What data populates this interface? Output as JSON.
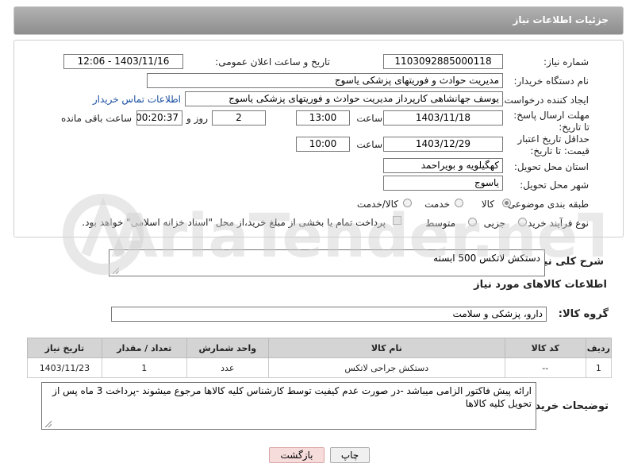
{
  "header": {
    "title": "جزئیات اطلاعات نیاز"
  },
  "labels": {
    "need_number": "شماره نیاز:",
    "announce_datetime": "تاریخ و ساعت اعلان عمومی:",
    "buyer_org": "نام دستگاه خریدار:",
    "creator": "ایجاد کننده درخواست:",
    "buyer_contact": "اطلاعات تماس خریدار",
    "reply_deadline": "مهلت ارسال پاسخ: تا تاریخ:",
    "time_word": "ساعت",
    "days_word": "روز و",
    "remaining_word": "ساعت باقی مانده",
    "price_validity": "حداقل تاریخ اعتبار قیمت: تا تاریخ:",
    "province": "استان محل تحویل:",
    "city": "شهر محل تحویل:",
    "subject_class": "طبقه بندی موضوعی:",
    "process_type": "نوع فرآیند خرید :",
    "description": "شرح کلی نیاز:",
    "items_section": "اطلاعات کالاهای مورد نیاز",
    "goods_group": "گروه کالا:",
    "buyer_notes": "توضیحات خریدار:"
  },
  "values": {
    "need_number": "1103092885000118",
    "announce_datetime": "1403/11/16 - 12:06",
    "buyer_org": "مدیریت حوادث و فوریتهای پزشکی یاسوج",
    "creator": "یوسف جهانشاهی کارپرداز  مدیریت حوادث و فوریتهای پزشکی یاسوج",
    "reply_date": "1403/11/18",
    "reply_time": "13:00",
    "days": "2",
    "remaining_time": "00:20:37",
    "validity_date": "1403/12/29",
    "validity_time": "10:00",
    "province": "کهگیلویه و بویراحمد",
    "city": "یاسوج",
    "description": "دستکش لاتکس 500 ابسته",
    "goods_group": "دارو، پزشکی و سلامت",
    "buyer_notes": "ارائه پیش فاکتور الزامی میباشد -در صورت عدم کیفیت توسط کارشناس کلیه کالاها مرجوع میشوند -پرداخت 3 ماه پس از تحویل کلیه کالاها"
  },
  "subject_options": [
    {
      "label": "کالا",
      "selected": true
    },
    {
      "label": "خدمت",
      "selected": false
    },
    {
      "label": "کالا/خدمت",
      "selected": false
    }
  ],
  "process_options": [
    {
      "label": "جزیی",
      "selected": false
    },
    {
      "label": "متوسط",
      "selected": false
    }
  ],
  "payment_note": "پرداخت تمام یا بخشی از مبلغ خرید،از محل \"اسناد خزانه اسلامی\" خواهد بود.",
  "table": {
    "headers": [
      "ردیف",
      "کد کالا",
      "نام کالا",
      "واحد شمارش",
      "تعداد / مقدار",
      "تاریخ نیاز"
    ],
    "rows": [
      [
        "1",
        "--",
        "دستکش جراحی لاتکس",
        "عدد",
        "1",
        "1403/11/23"
      ]
    ]
  },
  "buttons": {
    "print": "چاپ",
    "back": "بازگشت"
  },
  "watermark": {
    "text": "AriaTender.neT"
  }
}
